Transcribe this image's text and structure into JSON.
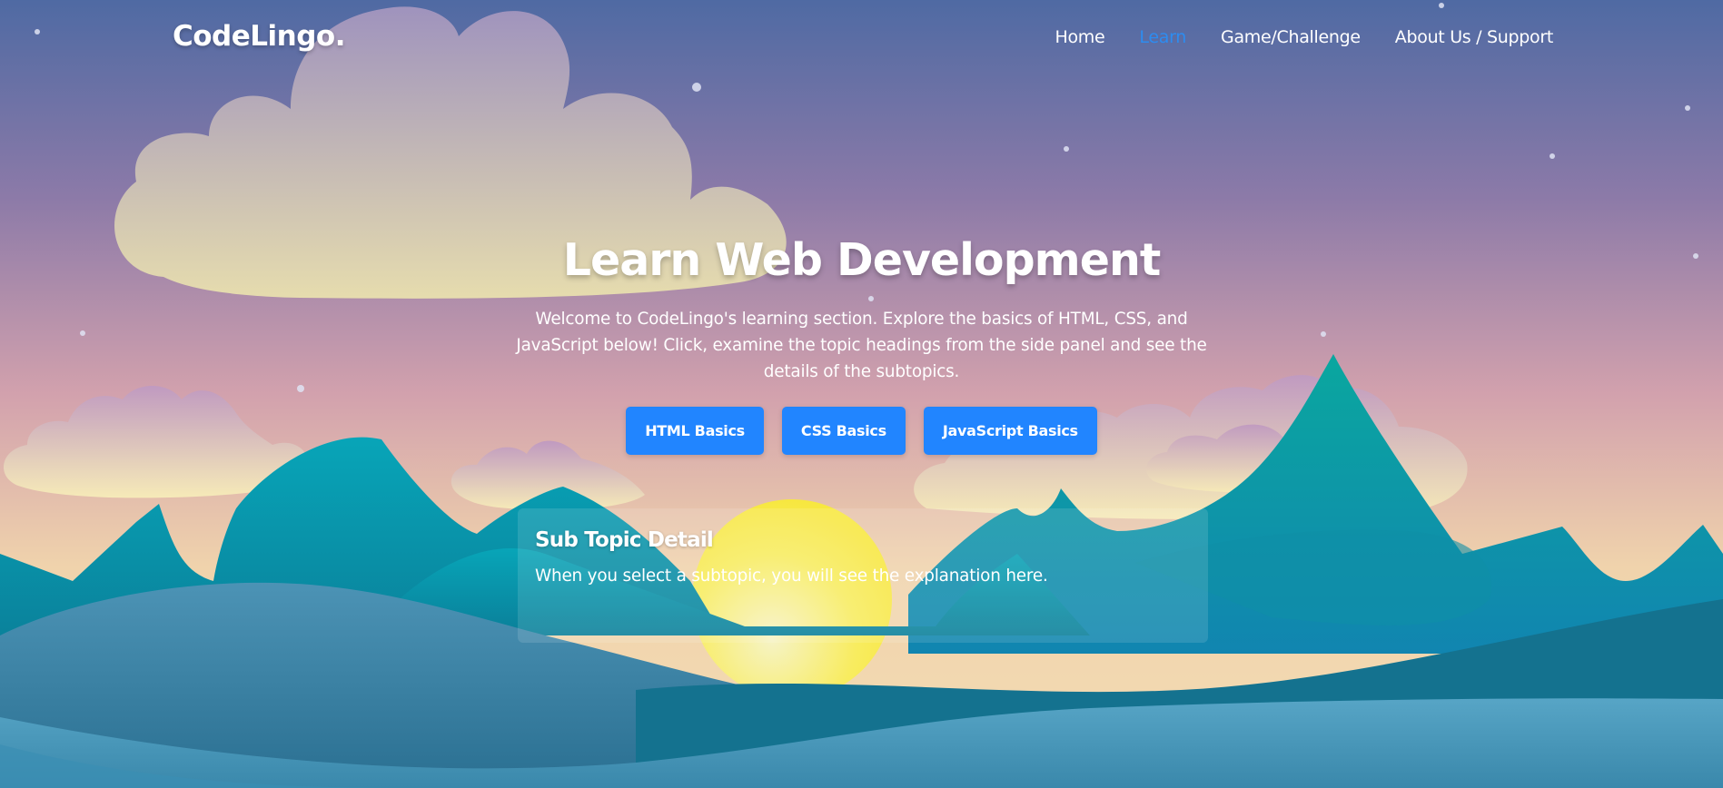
{
  "brand": {
    "name": "CodeLingo."
  },
  "nav": {
    "items": [
      {
        "label": "Home",
        "active": false
      },
      {
        "label": "Learn",
        "active": true
      },
      {
        "label": "Game/Challenge",
        "active": false
      },
      {
        "label": "About Us / Support",
        "active": false
      }
    ]
  },
  "hero": {
    "title": "Learn Web Development",
    "description": "Welcome to CodeLingo's learning section. Explore the basics of HTML, CSS, and JavaScript below! Click, examine the topic headings from the side panel and see the details of the subtopics."
  },
  "topics": {
    "buttons": [
      {
        "label": "HTML Basics"
      },
      {
        "label": "CSS Basics"
      },
      {
        "label": "JavaScript Basics"
      }
    ]
  },
  "detail": {
    "title": "Sub Topic Detail",
    "text": "When you select a subtopic, you will see the explanation here."
  },
  "colors": {
    "accent": "#2185ff",
    "active_nav": "#2d8cf0",
    "sky_top": "#4f6aa3",
    "sky_mid": "#9a7ba8",
    "sky_low": "#f0cfa4",
    "mountain": "#0e9bb0",
    "sun": "#f8ec48"
  }
}
